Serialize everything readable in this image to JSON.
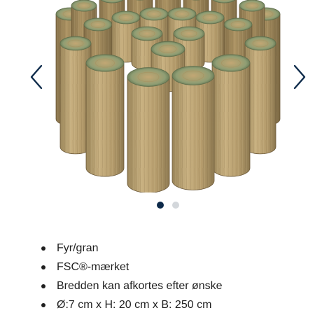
{
  "product": {
    "image_alt": "Wooden log roll edging",
    "features": [
      "Fyr/gran",
      "FSC®-mærket",
      "Bredden kan afkortes efter ønske",
      "Ø:7 cm x H: 20 cm x B: 250 cm"
    ]
  },
  "gallery": {
    "slide_count": 2,
    "active_index": 0,
    "prev_icon": "chevron-left-icon",
    "next_icon": "chevron-right-icon"
  },
  "colors": {
    "arrow": "#0d2a4a",
    "dot_active": "#0d2a4a",
    "dot_inactive": "#d3d7db",
    "text": "#1f1f1f"
  }
}
